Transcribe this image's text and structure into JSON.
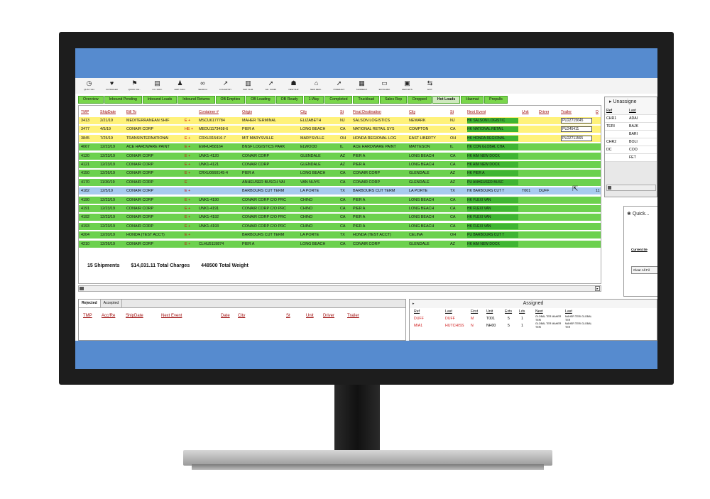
{
  "toolbar": [
    {
      "label": "QUSY S44",
      "icon": "clock-icon",
      "glyph": "◷"
    },
    {
      "label": "FCTRAILER",
      "icon": "heart-icon",
      "glyph": "♥"
    },
    {
      "label": "QUICK VIE...",
      "icon": "flag-icon",
      "glyph": "⚑"
    },
    {
      "label": "CO. INFO.",
      "icon": "document-icon",
      "glyph": "▤"
    },
    {
      "label": "EMP. INFO.",
      "icon": "person-icon",
      "glyph": "♟"
    },
    {
      "label": "SEARCH",
      "icon": "binoculars-icon",
      "glyph": "∞"
    },
    {
      "label": "LOG ENTRY",
      "icon": "chart-icon",
      "glyph": "↗"
    },
    {
      "label": "SHP. SUM.",
      "icon": "bars-icon",
      "glyph": "▥"
    },
    {
      "label": "ED. SUMM",
      "icon": "arrow-icon",
      "glyph": "➚"
    },
    {
      "label": "NEW SHP",
      "icon": "people-icon",
      "glyph": "☗"
    },
    {
      "label": "NEW REM...",
      "icon": "home-icon",
      "glyph": "⌂"
    },
    {
      "label": "ITINERARY",
      "icon": "arrow-icon",
      "glyph": "➚"
    },
    {
      "label": "SHIPMENT",
      "icon": "grid-icon",
      "glyph": "▦"
    },
    {
      "label": "EDI SUMM.",
      "icon": "folder-icon",
      "glyph": "▭"
    },
    {
      "label": "REPORTS",
      "icon": "report-icon",
      "glyph": "▣"
    },
    {
      "label": "EXIT",
      "icon": "exit-icon",
      "glyph": "⇆"
    }
  ],
  "tabs": [
    "Overview",
    "Inbound Pending",
    "Inbound Loads",
    "Inbound Returns",
    "OB Empties",
    "OB Loading",
    "OB Ready",
    "1-Way",
    "Completed",
    "Truckload",
    "Sales Rep",
    "Dropped",
    "Hot Loads",
    "Hazmat",
    "Prepulls"
  ],
  "active_tab": "Hot Loads",
  "grid": {
    "headers": {
      "tmp": "TMP",
      "shipdate": "ShipDate",
      "billto": "Bill To",
      "container": "Container #",
      "origin": "Origin",
      "city": "City",
      "st": "St",
      "final": "Final Destination",
      "city2": "City",
      "st2": "St",
      "next": "Next Event",
      "unit": "Unit",
      "driver": "Driver",
      "trailer": "Trailer",
      "d": "D"
    },
    "rows": [
      {
        "c": "y",
        "tmp": "3413",
        "date": "2/21/19",
        "bill": "MEDITERRANEAN SHIF",
        "flag": "E +",
        "cont": "MSCU6177784",
        "orig": "MAHER TERMINAL",
        "city": "ELIZABETH",
        "st": "NJ",
        "fin": "SALSON LOGISTICS",
        "city2": "NEWARK",
        "st2": "NJ",
        "next": "HK SALSON LOGISTIC",
        "unit": "",
        "driver": "",
        "trailer": "PU2Z715645",
        "d": ""
      },
      {
        "c": "y",
        "tmp": "3477",
        "date": "4/5/19",
        "bill": "CONAIR CORP",
        "flag": "HE +",
        "cont": "MEDU1173458-6",
        "orig": "PIER A",
        "city": "LONG BEACH",
        "st": "CA",
        "fin": "NATIONAL RETAIL SYS",
        "city2": "COMPTON",
        "st2": "CA",
        "next": "HK NATIONAL RETAIL",
        "unit": "",
        "driver": "",
        "trailer": "PU245411",
        "d": ""
      },
      {
        "c": "y",
        "tmp": "3845",
        "date": "7/25/19",
        "bill": "TRANSINTERNATIONAI",
        "flag": "E +",
        "cont": "CRXU315416-7",
        "orig": "MIT MARYSVILLE",
        "city": "MARYSVILLE",
        "st": "OH",
        "fin": "HONDA REGIONAL LOG",
        "city2": "EAST LIBERTY",
        "st2": "OH",
        "next": "HK HONDA REGIONAL",
        "unit": "",
        "driver": "",
        "trailer": "PU2Z711565",
        "d": ""
      },
      {
        "c": "g",
        "tmp": "4067",
        "date": "12/23/19",
        "bill": "ACE HARDWARE PAINT",
        "flag": "E +",
        "cont": "EMHU458164",
        "orig": "BNSF LOGISTICS PARK",
        "city": "ELWOOD",
        "st": "IL",
        "fin": "ACE HARDWARE PAINT",
        "city2": "MATTESON",
        "st2": "IL",
        "next": "HK CON GLOBAL CHA",
        "unit": "",
        "driver": "",
        "trailer": "",
        "d": ""
      },
      {
        "c": "g",
        "tmp": "4120",
        "date": "12/23/19",
        "bill": "CONAIR CORP",
        "flag": "E +",
        "cont": "UNK1-4120",
        "orig": "CONAIR CORP",
        "city": "GLENDALE",
        "st": "AZ",
        "fin": "PIER A",
        "city2": "LONG BEACH",
        "st2": "CA",
        "next": "HK AIM NEW DOCK",
        "unit": "",
        "driver": "",
        "trailer": "",
        "d": ""
      },
      {
        "c": "g",
        "tmp": "4121",
        "date": "12/23/19",
        "bill": "CONAIR CORP",
        "flag": "E +",
        "cont": "UNK1-4121",
        "orig": "CONAIR CORP",
        "city": "GLENDALE",
        "st": "AZ",
        "fin": "PIER A",
        "city2": "LONG BEACH",
        "st2": "CA",
        "next": "HK AIM NEW DOCK",
        "unit": "",
        "driver": "",
        "trailer": "",
        "d": ""
      },
      {
        "c": "g",
        "tmp": "4150",
        "date": "12/26/19",
        "bill": "CONAIR CORP",
        "flag": "E +",
        "cont": "CRXU0660145-4",
        "orig": "PIER A",
        "city": "LONG BEACH",
        "st": "CA",
        "fin": "CONAIR CORP",
        "city2": "GLENDALE",
        "st2": "AZ",
        "next": "HK PIER A",
        "unit": "",
        "driver": "",
        "trailer": "",
        "d": ""
      },
      {
        "c": "g",
        "tmp": "4170",
        "date": "11/30/19",
        "bill": "CONAIR CORP",
        "flag": "E",
        "cont": "",
        "orig": "ANHEUSER BUSCH VAI",
        "city": "VAN NUYS",
        "st": "CA",
        "fin": "CONAIR CORP",
        "city2": "GLENDALE",
        "st2": "AZ",
        "next": "PU ANHEUSER BUSC",
        "unit": "",
        "driver": "",
        "trailer": "",
        "d": ""
      },
      {
        "c": "b",
        "tmp": "4182",
        "date": "12/5/19",
        "bill": "CONAIR CORP",
        "flag": "E +",
        "cont": "",
        "orig": "BARBOURS CUT TERM",
        "city": "LA PORTE",
        "st": "TX",
        "fin": "BARBOURS CUT TERM",
        "city2": "LA PORTE",
        "st2": "TX",
        "next": "HK BARBOURS CUT T",
        "unit": "T001",
        "driver": "DUFF",
        "trailer": "",
        "d": "11"
      },
      {
        "c": "g",
        "tmp": "4190",
        "date": "12/23/19",
        "bill": "CONAIR CORP",
        "flag": "E +",
        "cont": "UNK1-4190",
        "orig": "CONAIR CORP C/O PRC",
        "city": "CHINO",
        "st": "CA",
        "fin": "PIER A",
        "city2": "LONG BEACH",
        "st2": "CA",
        "next": "HK FLEXI VAN",
        "unit": "",
        "driver": "",
        "trailer": "",
        "d": ""
      },
      {
        "c": "g",
        "tmp": "4191",
        "date": "12/23/19",
        "bill": "CONAIR CORP",
        "flag": "E +",
        "cont": "UNK1-4191",
        "orig": "CONAIR CORP C/O PRC",
        "city": "CHINO",
        "st": "CA",
        "fin": "PIER A",
        "city2": "LONG BEACH",
        "st2": "CA",
        "next": "HK FLEXI VAN",
        "unit": "",
        "driver": "",
        "trailer": "",
        "d": ""
      },
      {
        "c": "g",
        "tmp": "4192",
        "date": "12/23/19",
        "bill": "CONAIR CORP",
        "flag": "E +",
        "cont": "UNK1-4192",
        "orig": "CONAIR CORP C/O PRC",
        "city": "CHINO",
        "st": "CA",
        "fin": "PIER A",
        "city2": "LONG BEACH",
        "st2": "CA",
        "next": "HK FLEXI VAN",
        "unit": "",
        "driver": "",
        "trailer": "",
        "d": ""
      },
      {
        "c": "g",
        "tmp": "4193",
        "date": "12/23/19",
        "bill": "CONAIR CORP",
        "flag": "E +",
        "cont": "UNK1-4193",
        "orig": "CONAIR CORP C/O PRC",
        "city": "CHINO",
        "st": "CA",
        "fin": "PIER A",
        "city2": "LONG BEACH",
        "st2": "CA",
        "next": "HK FLEXI VAN",
        "unit": "",
        "driver": "",
        "trailer": "",
        "d": ""
      },
      {
        "c": "g",
        "tmp": "4204",
        "date": "12/20/19",
        "bill": "HONDA (TEST ACCT)",
        "flag": "E +",
        "cont": "",
        "orig": "BARBOURS CUT TERM",
        "city": "LA PORTE",
        "st": "TX",
        "fin": "HONDA (TEST ACCT)",
        "city2": "CELINA",
        "st2": "OH",
        "next": "PU BARBOURS CUT T",
        "unit": "",
        "driver": "",
        "trailer": "",
        "d": ""
      },
      {
        "c": "g",
        "tmp": "4210",
        "date": "12/26/19",
        "bill": "CONAIR CORP",
        "flag": "E +",
        "cont": "CLHU5119874",
        "orig": "PIER A",
        "city": "LONG BEACH",
        "st": "CA",
        "fin": "CONAIR CORP",
        "city2": "GLENDALE",
        "st2": "AZ",
        "next": "HK AIM NEW DOCK",
        "unit": "",
        "driver": "",
        "trailer": "",
        "d": ""
      }
    ],
    "summary": {
      "shipments": "15 Shipments",
      "charges": "$14,031.11 Total Charges",
      "weight": "448500 Total Weight"
    }
  },
  "unassigned": {
    "title": "Unassigne",
    "headers": {
      "ref": "Ref",
      "last": "Last"
    },
    "rows": [
      {
        "ref": "CHR1",
        "last": "ADAI"
      },
      {
        "ref": "TERI",
        "last": "BAJK"
      },
      {
        "ref": "",
        "last": "BARI"
      },
      {
        "ref": "CHR2",
        "last": "BOLI"
      },
      {
        "ref": "DC",
        "last": "COO"
      },
      {
        "ref": "",
        "last": "FET"
      }
    ]
  },
  "quick": {
    "title": "Quick...",
    "current": "Current Ite",
    "clear": "Clear All Fil"
  },
  "bottom_left": {
    "tabs": [
      "Rejected",
      "Accepted"
    ],
    "headers": {
      "tmp": "TMP",
      "acc": "Acc/Re",
      "ship": "ShipDate",
      "next": "Next Event",
      "date": "Date",
      "city": "City",
      "st": "St",
      "unit": "Unit",
      "driver": "Driver",
      "trailer": "Trailer"
    }
  },
  "assigned": {
    "title": "Assigned",
    "headers": {
      "ref": "Ref",
      "last": "Last",
      "first": "First",
      "unit": "Unit",
      "exts": "Exts",
      "lds": "Lds",
      "next": "Next",
      "last2": "Last"
    },
    "rows": [
      {
        "ref": "DUFF",
        "last": "DUFF",
        "first": "M",
        "unit": "T001",
        "exts": "5",
        "lds": "1",
        "next": "GLOBAL TER MAHER TERI",
        "last2": "MAHER TERI GLOBAL TER"
      },
      {
        "ref": "MIA1",
        "last": "HUTCHISS",
        "first": "N",
        "unit": "NH00",
        "exts": "5",
        "lds": "1",
        "next": "GLOBAL TER MAHER TERI",
        "last2": "MAHER TERI GLOBAL TER"
      }
    ]
  },
  "colors": {
    "screen_bar": "#568bcf",
    "yellow_row": "#fff27a",
    "green_row": "#6cd14e",
    "blue_row": "#a8cbef"
  }
}
